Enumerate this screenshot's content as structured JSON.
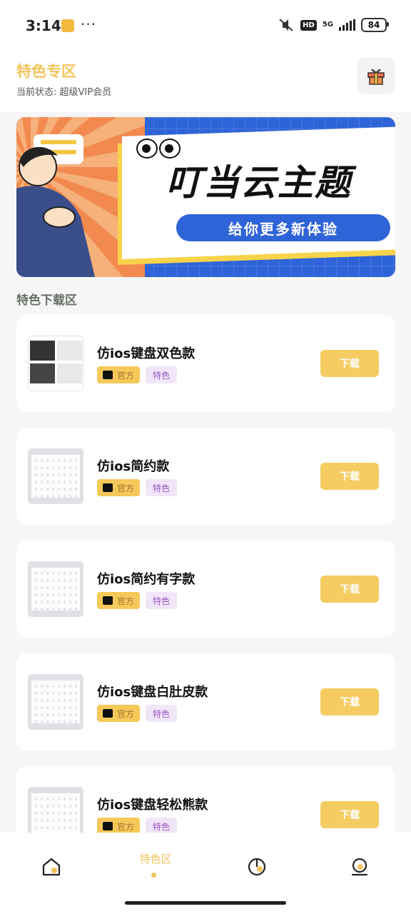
{
  "status": {
    "time": "3:14",
    "network": "5G",
    "hd": "HD",
    "battery": "84"
  },
  "header": {
    "title": "特色专区",
    "subtitle": "当前状态: 超级VIP会员"
  },
  "banner": {
    "headline": "叮当云主题",
    "tagline": "给你更多新体验"
  },
  "section_title": "特色下载区",
  "items": [
    {
      "name": "仿ios键盘双色款",
      "tag_official": "官方",
      "tag_special": "特色",
      "button": "下载"
    },
    {
      "name": "仿ios简约款",
      "tag_official": "官方",
      "tag_special": "特色",
      "button": "下载"
    },
    {
      "name": "仿ios简约有字款",
      "tag_official": "官方",
      "tag_special": "特色",
      "button": "下载"
    },
    {
      "name": "仿ios键盘白肚皮款",
      "tag_official": "官方",
      "tag_special": "特色",
      "button": "下载"
    },
    {
      "name": "仿ios键盘轻松熊款",
      "tag_official": "官方",
      "tag_special": "特色",
      "button": "下载"
    }
  ],
  "nav": {
    "active_label": "特色区",
    "icons": [
      "home-icon",
      "pie-chart-icon",
      "profile-icon"
    ]
  },
  "colors": {
    "accent": "#f2c55c",
    "button": "#f5cc61",
    "banner_blue": "#2f64d8",
    "special_tag_bg": "#f1e6f7",
    "special_tag_text": "#9b55c5"
  }
}
